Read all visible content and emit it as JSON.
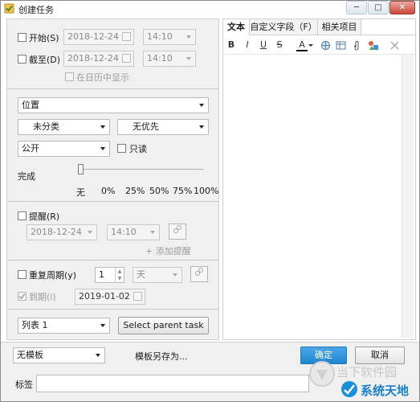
{
  "window": {
    "title": "创建任务",
    "minimize_label": "─",
    "maximize_label": "□",
    "close_label": "✕"
  },
  "start": {
    "label": "开始(S)",
    "date": "2018-12-24",
    "time": "14:10"
  },
  "due": {
    "label": "截至(D)",
    "date": "2018-12-24",
    "time": "14:10"
  },
  "show_in_calendar": "在日历中显示",
  "location": {
    "value": "位置"
  },
  "category": {
    "value": "未分类"
  },
  "priority": {
    "value": "无优先"
  },
  "visibility": {
    "value": "公开"
  },
  "readonly": {
    "label": "只读"
  },
  "completion": {
    "label": "完成",
    "ticks": [
      "无",
      "0%",
      "25%",
      "50%",
      "75%",
      "100%"
    ]
  },
  "reminder": {
    "label": "提醒(R)",
    "date": "2018-12-24",
    "time": "14:10",
    "add_label": "添加提醒",
    "plus": "+"
  },
  "recurrence": {
    "label": "重复周期(y)",
    "count": "1",
    "unit": "天"
  },
  "expiry": {
    "label": "到期(i)",
    "date": "2019-01-02"
  },
  "list": {
    "value": "列表 1"
  },
  "select_parent": "Select parent task",
  "tabs": [
    "文本",
    "自定义字段（F）",
    "相关项目"
  ],
  "toolbar": {
    "bold": "B",
    "italic": "I",
    "underline": "U",
    "strike": "S",
    "font_color": "A"
  },
  "template": {
    "value": "无模板",
    "save_as": "模板另存为..."
  },
  "ok": "确定",
  "cancel": "取消",
  "tags": {
    "label": "标签"
  },
  "watermark": {
    "site1": "当下软件园",
    "site2": "系统天地"
  }
}
